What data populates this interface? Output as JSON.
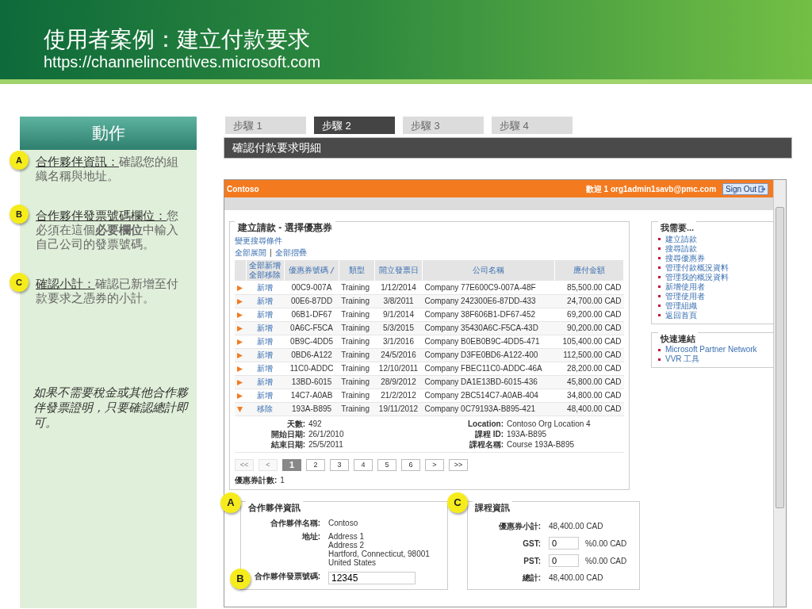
{
  "slide": {
    "title": "使用者案例：建立付款要求",
    "url": "https://channelincentives.microsoft.com"
  },
  "panel": {
    "heading": "動作",
    "items": [
      {
        "marker": "A",
        "lead": "合作夥伴資訊：",
        "text": "確認您的組織名稱與地址。"
      },
      {
        "marker": "B",
        "lead": "合作夥伴發票號碼欄位：",
        "text": "您必須在這個**必要欄位**中輸入自己公司的發票號碼。"
      },
      {
        "marker": "C",
        "lead": "確認小計：",
        "text": "確認已新增至付款要求之憑券的小計。"
      }
    ],
    "note": "如果不需要稅金或其他合作夥伴發票證明，只要確認總計即可。"
  },
  "steps": [
    {
      "label": "步驟 1",
      "selected": false
    },
    {
      "label": "步驟 2",
      "selected": true
    },
    {
      "label": "步驟 3",
      "selected": false
    },
    {
      "label": "步驟 4",
      "selected": false
    }
  ],
  "step_caption": "確認付款要求明細",
  "app": {
    "brand": "Contoso",
    "welcome": "歡迎 1 org1admin1savb@pmc.com",
    "sign_out": "Sign Out",
    "vouchers": {
      "title": "建立請款 - 選擇優惠券",
      "change_link": "變更搜尋條件",
      "expand_all": "全部展開",
      "separator": "|",
      "collapse_all": "全部摺疊",
      "add_all": "全部新增",
      "remove_all": "全部移除",
      "columns": [
        "優惠券號碼",
        "類型",
        "開立發票日",
        "公司名稱",
        "應付金額"
      ],
      "rows": [
        {
          "expanded": false,
          "action": "新增",
          "code": "00C9-007A",
          "type": "Training",
          "date": "1/12/2014",
          "company": "Company 77E600C9-007A-48F",
          "amount": "85,500.00 CAD"
        },
        {
          "expanded": false,
          "action": "新增",
          "code": "00E6-87DD",
          "type": "Training",
          "date": "3/8/2011",
          "company": "Company 242300E6-87DD-433",
          "amount": "24,700.00 CAD"
        },
        {
          "expanded": false,
          "action": "新增",
          "code": "06B1-DF67",
          "type": "Training",
          "date": "9/1/2014",
          "company": "Company 38F606B1-DF67-452",
          "amount": "69,200.00 CAD"
        },
        {
          "expanded": false,
          "action": "新增",
          "code": "0A6C-F5CA",
          "type": "Training",
          "date": "5/3/2015",
          "company": "Company 35430A6C-F5CA-43D",
          "amount": "90,200.00 CAD"
        },
        {
          "expanded": false,
          "action": "新增",
          "code": "0B9C-4DD5",
          "type": "Training",
          "date": "3/1/2016",
          "company": "Company B0EB0B9C-4DD5-471",
          "amount": "105,400.00 CAD"
        },
        {
          "expanded": false,
          "action": "新增",
          "code": "0BD6-A122",
          "type": "Training",
          "date": "24/5/2016",
          "company": "Company D3FE0BD6-A122-400",
          "amount": "112,500.00 CAD"
        },
        {
          "expanded": false,
          "action": "新增",
          "code": "11C0-ADDC",
          "type": "Training",
          "date": "12/10/2011",
          "company": "Company FBEC11C0-ADDC-46A",
          "amount": "28,200.00 CAD"
        },
        {
          "expanded": false,
          "action": "新增",
          "code": "13BD-6015",
          "type": "Training",
          "date": "28/9/2012",
          "company": "Company DA1E13BD-6015-436",
          "amount": "45,800.00 CAD"
        },
        {
          "expanded": false,
          "action": "新增",
          "code": "14C7-A0AB",
          "type": "Training",
          "date": "21/2/2012",
          "company": "Company 2BC514C7-A0AB-404",
          "amount": "34,800.00 CAD"
        },
        {
          "expanded": true,
          "action": "移除",
          "code": "193A-B895",
          "type": "Training",
          "date": "19/11/2012",
          "company": "Company 0C79193A-B895-421",
          "amount": "48,400.00 CAD",
          "details": {
            "left": [
              {
                "label": "天數:",
                "value": "492"
              },
              {
                "label": "開始日期:",
                "value": "26/1/2010"
              },
              {
                "label": "結束日期:",
                "value": "25/5/2011"
              }
            ],
            "right": [
              {
                "label": "Location:",
                "value": "Contoso Org Location 4"
              },
              {
                "label": "課程 ID:",
                "value": "193A-B895"
              },
              {
                "label": "課程名稱:",
                "value": "Course 193A-B895"
              }
            ]
          }
        }
      ],
      "pages": [
        {
          "label": "<<",
          "selected": false,
          "disabled": true
        },
        {
          "label": "<",
          "selected": false,
          "disabled": true
        },
        {
          "label": "1",
          "selected": true,
          "disabled": false
        },
        {
          "label": "2",
          "selected": false,
          "disabled": false
        },
        {
          "label": "3",
          "selected": false,
          "disabled": false
        },
        {
          "label": "4",
          "selected": false,
          "disabled": false
        },
        {
          "label": "5",
          "selected": false,
          "disabled": false
        },
        {
          "label": "6",
          "selected": false,
          "disabled": false
        },
        {
          "label": ">",
          "selected": false,
          "disabled": false
        },
        {
          "label": ">>",
          "selected": false,
          "disabled": false
        }
      ],
      "count": {
        "label": "優惠券計數:",
        "value": "1"
      }
    },
    "sidebar": [
      {
        "title": "我需要...",
        "links": [
          "建立請款",
          "搜尋請款",
          "搜尋優惠券",
          "管理付款概況資料",
          "管理我的概況資料",
          "新增使用者",
          "管理使用者",
          "管理組織",
          "返回首頁"
        ]
      },
      {
        "title": "快速連結",
        "links": [
          "Microsoft Partner Network",
          "VVR 工具"
        ]
      }
    ],
    "partner": {
      "marker": "A",
      "title": "合作夥伴資訊",
      "name": {
        "label": "合作夥伴名稱:",
        "value": "Contoso"
      },
      "address": {
        "label": "地址:",
        "lines": [
          "Address 1",
          "Address 2",
          "Hartford, Connecticut, 98001",
          "United States"
        ]
      },
      "invoice": {
        "marker": "B",
        "label": "合作夥伴發票號碼:",
        "value": "12345"
      }
    },
    "course": {
      "marker": "C",
      "title": "課程資訊",
      "subtotal": {
        "label": "優惠券小計:",
        "value": "48,400.00 CAD"
      },
      "taxes": [
        {
          "label": "GST:",
          "value": "0",
          "amount": "%0.00 CAD"
        },
        {
          "label": "PST:",
          "value": "0",
          "amount": "%0.00 CAD"
        }
      ],
      "total": {
        "label": "總計:",
        "value": "48,400.00 CAD"
      }
    }
  }
}
